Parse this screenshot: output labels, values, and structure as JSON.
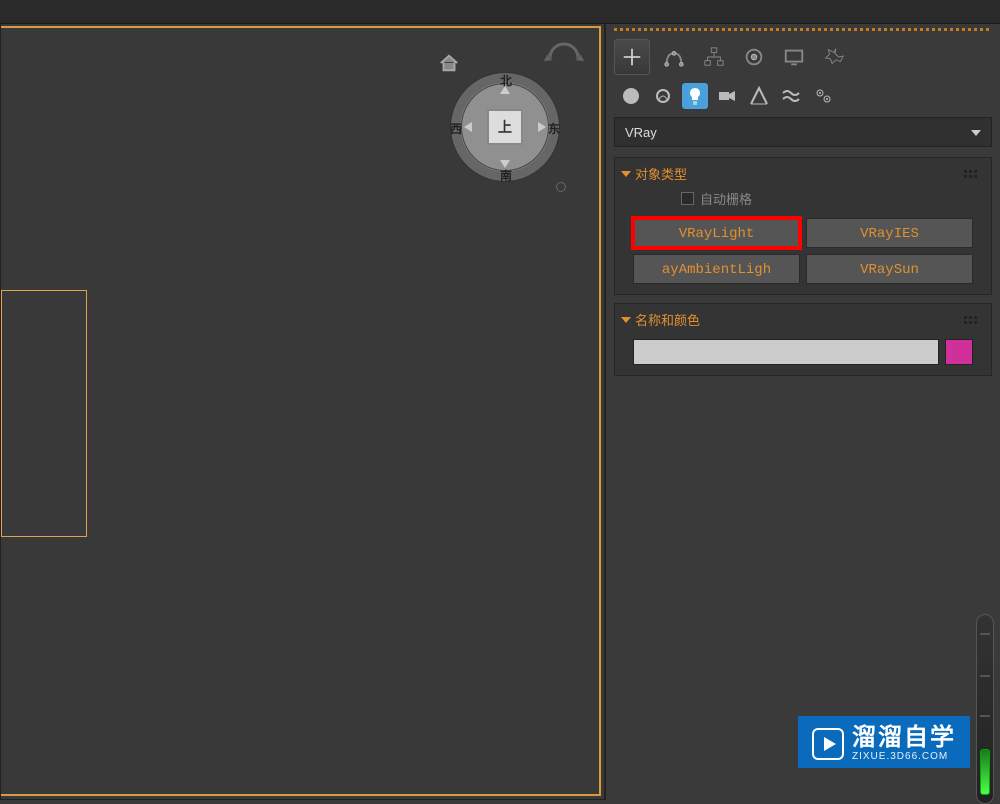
{
  "viewport": {
    "dir_n": "北",
    "dir_s": "南",
    "dir_e": "东",
    "dir_w": "西",
    "face": "上"
  },
  "panel": {
    "dropdown_value": "VRay",
    "rollout1_title": "对象类型",
    "autogrid_label": "自动栅格",
    "buttons": {
      "vraylight": "VRayLight",
      "vrayies": "VRayIES",
      "ambient": "ayAmbientLigh",
      "vraysun": "VRaySun"
    },
    "rollout2_title": "名称和颜色",
    "name_value": "",
    "color": "#d1309b"
  },
  "watermark": {
    "title": "溜溜自学",
    "sub": "ZIXUE.3D66.COM"
  }
}
